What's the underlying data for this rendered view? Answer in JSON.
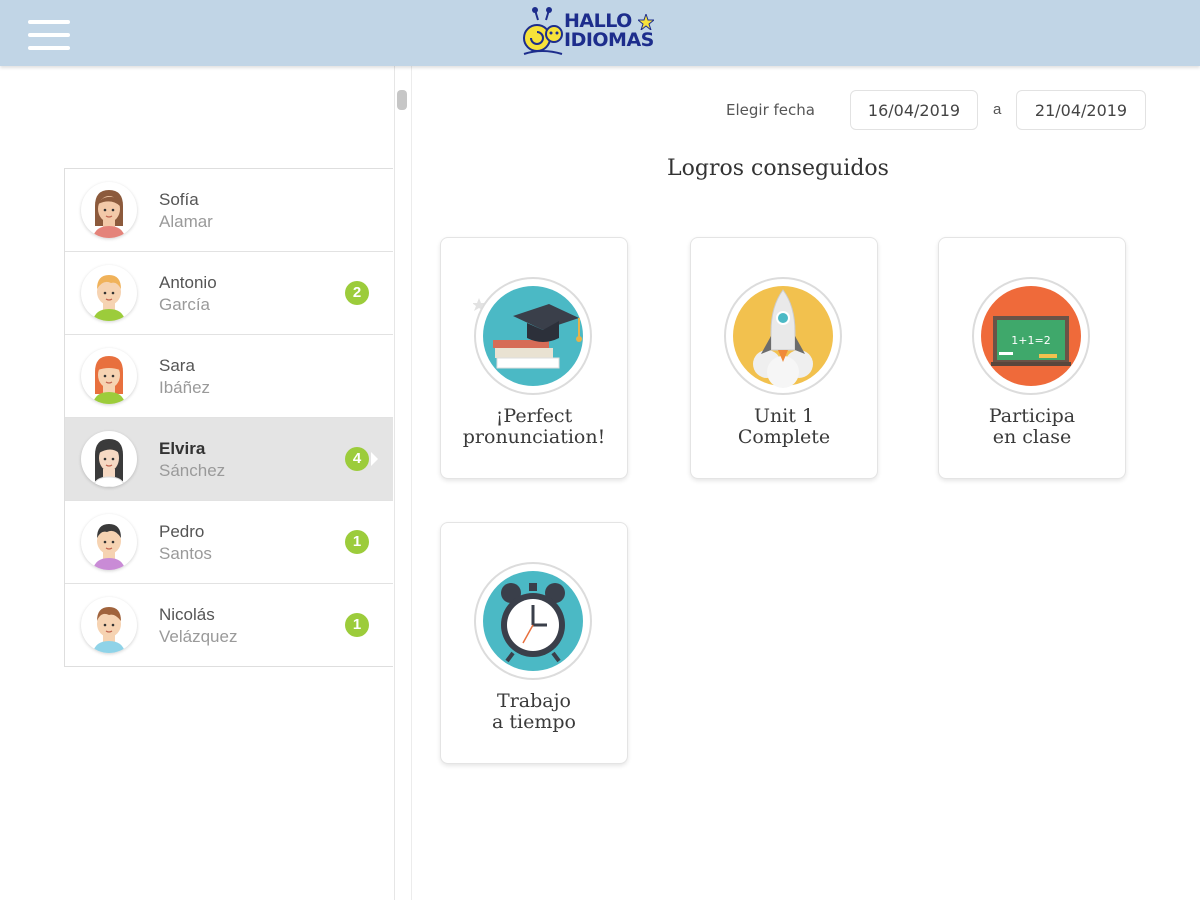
{
  "app": {
    "logo_line1": "HALLO",
    "logo_line2": "IDIOMAS",
    "brand_color": "#1d2d8c",
    "header_color": "#c1d5e6"
  },
  "filter": {
    "label": "Elegir fecha",
    "from": "16/04/2019",
    "separator": "a",
    "to": "21/04/2019"
  },
  "section_title": "Logros conseguidos",
  "students": [
    {
      "first": "Sofía",
      "last": "Alamar",
      "badge": "",
      "selected": false
    },
    {
      "first": "Antonio",
      "last": "García",
      "badge": "2",
      "selected": false
    },
    {
      "first": "Sara",
      "last": "Ibáñez",
      "badge": "",
      "selected": false
    },
    {
      "first": "Elvira",
      "last": "Sánchez",
      "badge": "4",
      "selected": true
    },
    {
      "first": "Pedro",
      "last": "Santos",
      "badge": "1",
      "selected": false
    },
    {
      "first": "Nicolás",
      "last": "Velázquez",
      "badge": "1",
      "selected": false
    }
  ],
  "achievements": [
    {
      "label": "¡Perfect\npronunciation!",
      "icon": "graduation-cap-icon",
      "color": "#4bb9c5"
    },
    {
      "label": "Unit 1\nComplete",
      "icon": "rocket-icon",
      "color": "#f2c14e"
    },
    {
      "label": "Participa\nen clase",
      "icon": "blackboard-icon",
      "color": "#ef6a3a"
    },
    {
      "label": "Trabajo\na tiempo",
      "icon": "alarm-clock-icon",
      "color": "#4bb9c5"
    }
  ],
  "badge_color": "#9ccc3b"
}
